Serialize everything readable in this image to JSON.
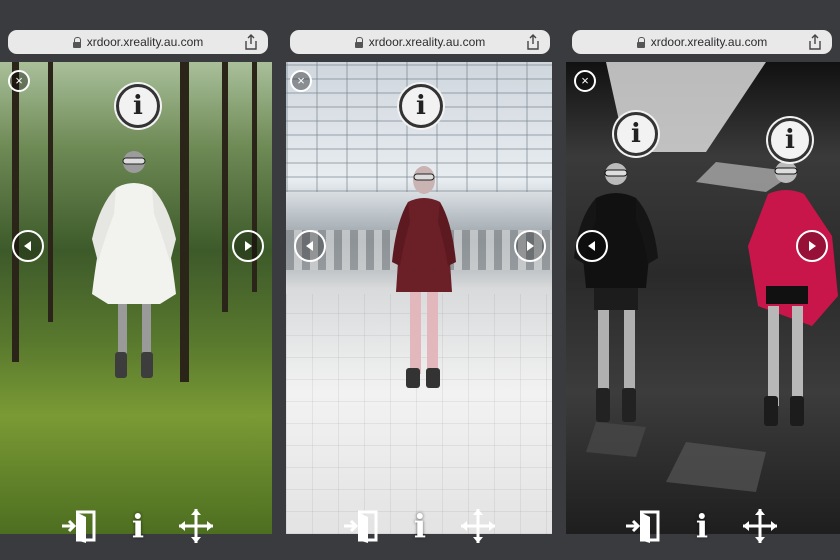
{
  "screens": [
    {
      "url": "xrdoor.xreality.au.com",
      "environment": "forest"
    },
    {
      "url": "xrdoor.xreality.au.com",
      "environment": "glass-hall"
    },
    {
      "url": "xrdoor.xreality.au.com",
      "environment": "dark-room"
    }
  ],
  "icons": {
    "close": "×",
    "info": "i"
  },
  "colors": {
    "frame": "#3a3b3f",
    "urlbar": "#e9e9ea",
    "icon_white": "#ffffff"
  }
}
